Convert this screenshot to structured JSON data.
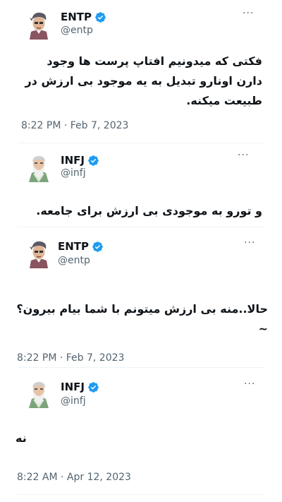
{
  "tweets": [
    {
      "name": "ENTP",
      "handle": "@entp",
      "text": "فکتی که میدونیم افتاپ پرست ها وجود دارن اونارو تبدیل به یه موجود بی ارزش در طبیعت میکنه.",
      "time": "8:22 PM · Feb 7, 2023",
      "avatar_icon": "entp-avatar",
      "more_icon": "more-horizontal-icon",
      "verified_icon": "verified-badge-icon"
    },
    {
      "name": "INFJ",
      "handle": "@infj",
      "text": "و تورو به موجودی بی ارزش برای جامعه.",
      "time": "",
      "avatar_icon": "infj-avatar",
      "more_icon": "more-horizontal-icon",
      "verified_icon": "verified-badge-icon"
    },
    {
      "name": "ENTP",
      "handle": "@entp",
      "text": "حالا..منه بی ارزش میتونم با شما بیام بیرون؟~",
      "time": "8:22 PM · Feb 7, 2023",
      "avatar_icon": "entp-avatar",
      "more_icon": "more-horizontal-icon",
      "verified_icon": "verified-badge-icon"
    },
    {
      "name": "INFJ",
      "handle": "@infj",
      "text": "نه",
      "time": "8:22 AM · Apr 12, 2023",
      "avatar_icon": "infj-avatar",
      "more_icon": "more-horizontal-icon",
      "verified_icon": "verified-badge-icon"
    }
  ],
  "more_label": "···",
  "colors": {
    "verified_blue": "#1d9bf0",
    "secondary_text": "#536471",
    "divider": "#eff3f4"
  }
}
